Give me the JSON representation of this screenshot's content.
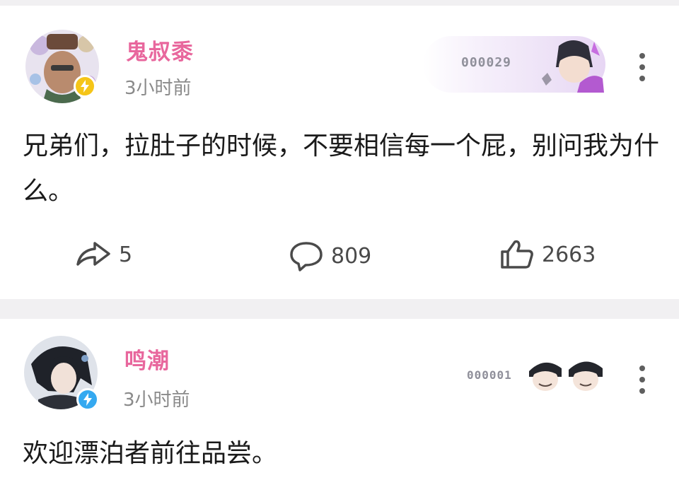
{
  "posts": [
    {
      "username": "鬼叔黍",
      "time": "3小时前",
      "content": "兄弟们，拉肚子的时候，不要相信每一个屁，别问我为什么。",
      "deco_number": "000029",
      "actions": {
        "share": "5",
        "comment": "809",
        "like": "2663"
      },
      "verified_badge_color": "#f5c518"
    },
    {
      "username": "鸣潮",
      "time": "3小时前",
      "content": "欢迎漂泊者前往品尝。",
      "deco_number": "000001",
      "verified_badge_color": "#35a9f0"
    }
  ],
  "colors": {
    "username": "#e8679d",
    "background": "#f1f0f2",
    "card": "#ffffff",
    "meta_text": "#8a8a8a"
  },
  "icons": [
    "share-icon",
    "comment-icon",
    "like-icon",
    "more-icon",
    "verified-badge-icon"
  ]
}
